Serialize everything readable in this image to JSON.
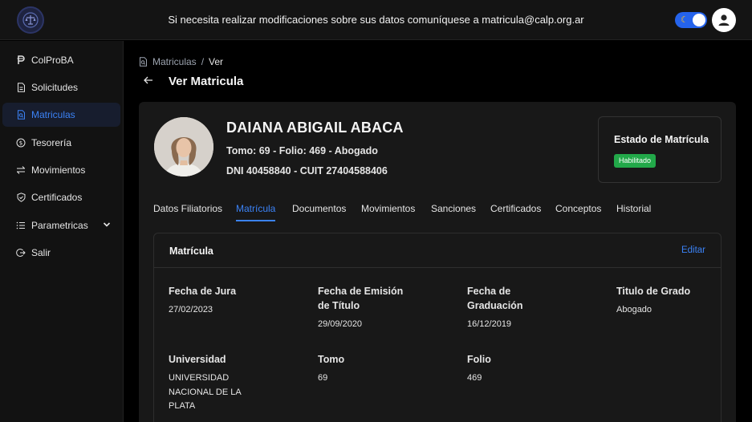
{
  "topbar": {
    "message": "Si necesita realizar modificaciones sobre sus datos comuníquese a matricula@calp.org.ar",
    "logo_icon": "balance-seal-icon",
    "theme_toggle_icon": "moon-icon",
    "user_icon": "user-avatar-icon"
  },
  "sidebar": {
    "items": [
      {
        "label": "ColProBA",
        "icon": "peso-icon"
      },
      {
        "label": "Solicitudes",
        "icon": "document-icon"
      },
      {
        "label": "Matriculas",
        "icon": "document-search-icon"
      },
      {
        "label": "Tesorería",
        "icon": "coin-icon"
      },
      {
        "label": "Movimientos",
        "icon": "transfer-icon"
      },
      {
        "label": "Certificados",
        "icon": "shield-check-icon"
      },
      {
        "label": "Parametricas",
        "icon": "list-icon"
      },
      {
        "label": "Salir",
        "icon": "logout-icon"
      }
    ],
    "active_index": 2
  },
  "breadcrumb": {
    "parent": "Matriculas",
    "separator": "/",
    "current": "Ver"
  },
  "page": {
    "title": "Ver Matricula"
  },
  "profile": {
    "name": "DAIANA ABIGAIL ABACA",
    "line1": "Tomo: 69 - Folio: 469 - Abogado",
    "line2": "DNI 40458840 - CUIT 27404588406"
  },
  "estado": {
    "title": "Estado de Matrícula",
    "badge": "Habilitado",
    "badge_color": "#22a849"
  },
  "tabs": [
    "Datos Filiatorios",
    "Matrícula",
    "Documentos",
    "Movimientos",
    "Sanciones",
    "Certificados",
    "Conceptos",
    "Historial"
  ],
  "active_tab": 1,
  "matricula": {
    "title": "Matrícula",
    "edit_label": "Editar",
    "fields": {
      "fecha_jura": {
        "label": "Fecha de Jura",
        "value": "27/02/2023"
      },
      "fecha_emision": {
        "label": "Fecha de Emisión de Título",
        "value": "29/09/2020"
      },
      "fecha_graduacion": {
        "label": "Fecha de Graduación",
        "value": "16/12/2019"
      },
      "titulo": {
        "label": "Titulo de Grado",
        "value": "Abogado"
      },
      "universidad": {
        "label": "Universidad",
        "value": "UNIVERSIDAD NACIONAL DE LA PLATA"
      },
      "tomo": {
        "label": "Tomo",
        "value": "69"
      },
      "folio": {
        "label": "Folio",
        "value": "469"
      }
    }
  },
  "colors": {
    "accent": "#3b82f6",
    "background": "#000000",
    "card": "#181818"
  }
}
